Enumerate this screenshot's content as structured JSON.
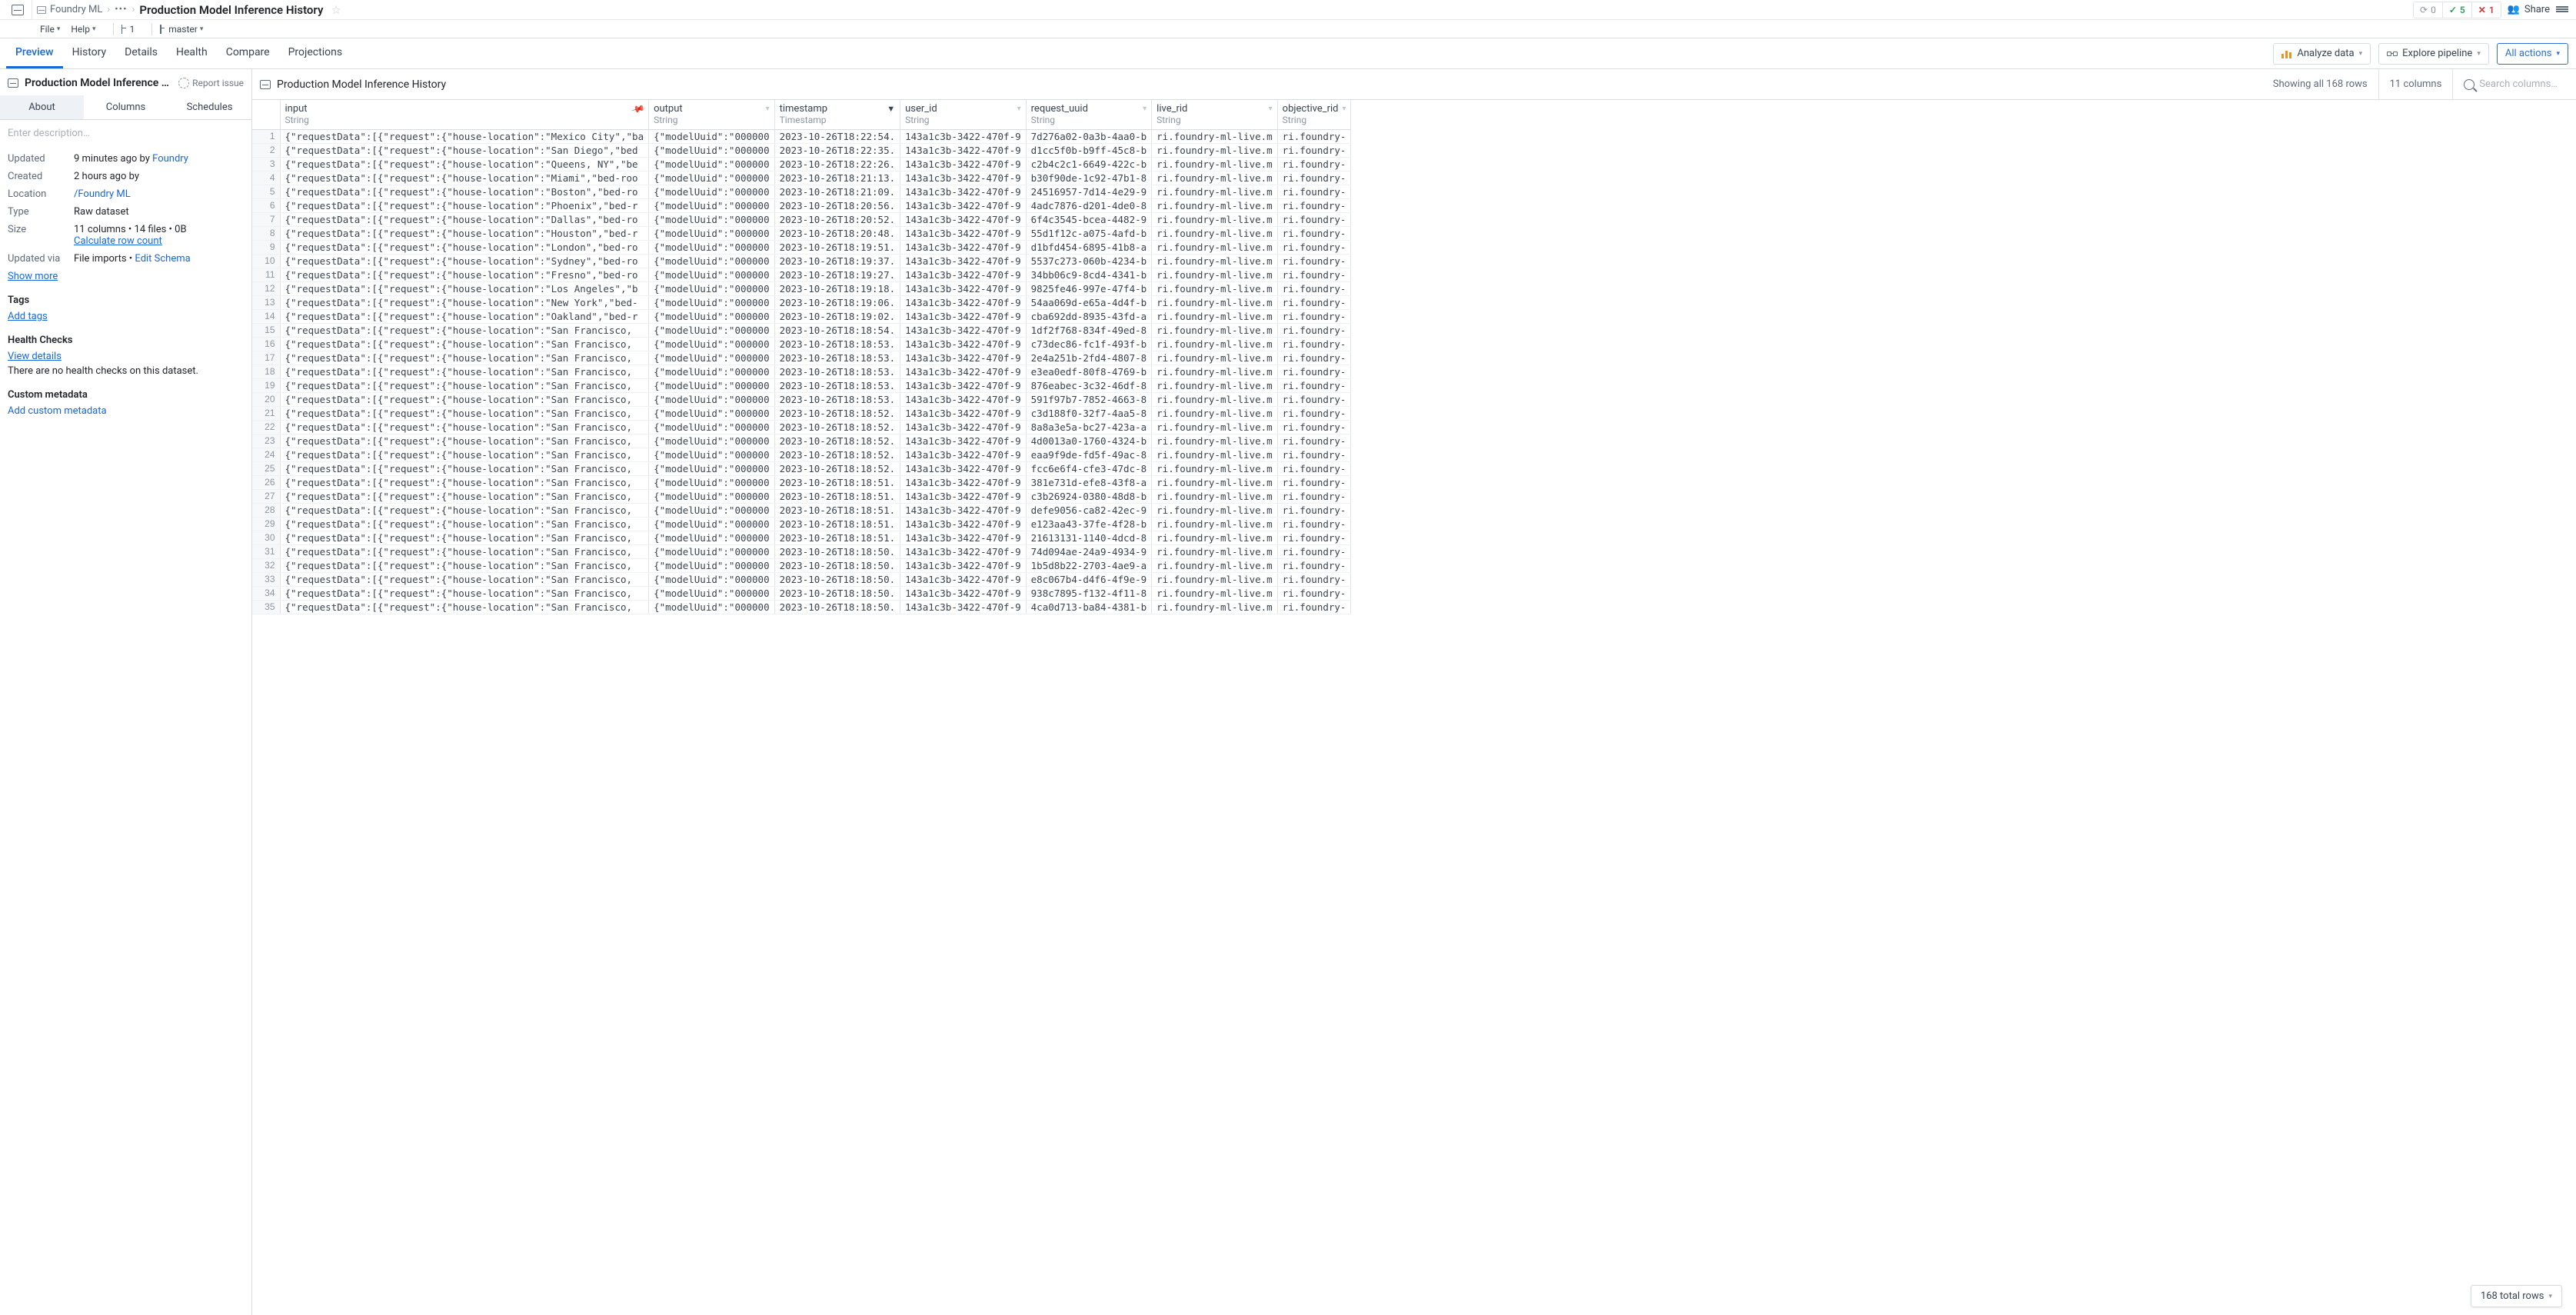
{
  "breadcrumb": {
    "project": "Foundry ML",
    "title": "Production Model Inference History"
  },
  "status": {
    "refresh": "0",
    "ok": "5",
    "err": "1"
  },
  "topbar": {
    "share": "Share"
  },
  "menubar": {
    "file": "File",
    "help": "Help",
    "branch_count": "1",
    "branch": "master"
  },
  "navtabs": [
    "Preview",
    "History",
    "Details",
    "Health",
    "Compare",
    "Projections"
  ],
  "nav_active": 0,
  "nav_buttons": {
    "analyze": "Analyze data",
    "explore": "Explore pipeline",
    "all_actions": "All actions"
  },
  "sidebar": {
    "title": "Production Model Inference History",
    "report_issue": "Report issue",
    "tabs": [
      "About",
      "Columns",
      "Schedules"
    ],
    "active_tab": 0,
    "description_placeholder": "Enter description…",
    "meta": {
      "updated_label": "Updated",
      "updated_value": "9 minutes ago by ",
      "updated_by": "Foundry",
      "created_label": "Created",
      "created_value": "2 hours ago by",
      "location_label": "Location",
      "location_value": "/Foundry ML",
      "type_label": "Type",
      "type_value": "Raw dataset",
      "size_label": "Size",
      "size_value": "11 columns • 14 files • 0B",
      "calc_rows": "Calculate row count",
      "updated_via_label": "Updated via",
      "updated_via_value": "File imports • ",
      "edit_schema": "Edit Schema",
      "show_more": "Show more"
    },
    "tags_h": "Tags",
    "add_tags": "Add tags",
    "health_h": "Health Checks",
    "view_details": "View details",
    "health_none": "There are no health checks on this dataset.",
    "custom_h": "Custom metadata",
    "add_custom": "Add custom metadata"
  },
  "content": {
    "title": "Production Model Inference History",
    "rows_stat": "Showing all 168 rows",
    "cols_stat": "11 columns",
    "search_placeholder": "Search columns…",
    "footer": "168 total rows"
  },
  "columns": [
    {
      "name": "input",
      "type": "String",
      "pin": true
    },
    {
      "name": "output",
      "type": "String"
    },
    {
      "name": "timestamp",
      "type": "Timestamp",
      "sort": "desc"
    },
    {
      "name": "user_id",
      "type": "String"
    },
    {
      "name": "request_uuid",
      "type": "String"
    },
    {
      "name": "live_rid",
      "type": "String"
    },
    {
      "name": "objective_rid",
      "type": "String"
    }
  ],
  "rows": [
    {
      "loc": "Mexico City",
      "inpSuffix": "\",\"ba",
      "ts": "2023-10-26T18:22:54.",
      "req": "7d276a02-0a3b-4aa0-b"
    },
    {
      "loc": "San Diego",
      "inpSuffix": "\",\"bed",
      "ts": "2023-10-26T18:22:35.",
      "req": "d1cc5f0b-b9ff-45c8-b"
    },
    {
      "loc": "Queens, NY",
      "inpSuffix": "\",\"be",
      "ts": "2023-10-26T18:22:26.",
      "req": "c2b4c2c1-6649-422c-b"
    },
    {
      "loc": "Miami",
      "inpSuffix": "\",\"bed-roo",
      "ts": "2023-10-26T18:21:13.",
      "req": "b30f90de-1c92-47b1-8"
    },
    {
      "loc": "Boston",
      "inpSuffix": "\",\"bed-ro",
      "ts": "2023-10-26T18:21:09.",
      "req": "24516957-7d14-4e29-9"
    },
    {
      "loc": "Phoenix",
      "inpSuffix": "\",\"bed-r",
      "ts": "2023-10-26T18:20:56.",
      "req": "4adc7876-d201-4de0-8"
    },
    {
      "loc": "Dallas",
      "inpSuffix": "\",\"bed-ro",
      "ts": "2023-10-26T18:20:52.",
      "req": "6f4c3545-bcea-4482-9"
    },
    {
      "loc": "Houston",
      "inpSuffix": "\",\"bed-r",
      "ts": "2023-10-26T18:20:48.",
      "req": "55d1f12c-a075-4afd-b"
    },
    {
      "loc": "London",
      "inpSuffix": "\",\"bed-ro",
      "ts": "2023-10-26T18:19:51.",
      "req": "d1bfd454-6895-41b8-a"
    },
    {
      "loc": "Sydney",
      "inpSuffix": "\",\"bed-ro",
      "ts": "2023-10-26T18:19:37.",
      "req": "5537c273-060b-4234-b"
    },
    {
      "loc": "Fresno",
      "inpSuffix": "\",\"bed-ro",
      "ts": "2023-10-26T18:19:27.",
      "req": "34bb06c9-8cd4-4341-b"
    },
    {
      "loc": "Los Angeles",
      "inpSuffix": "\",\"b",
      "ts": "2023-10-26T18:19:18.",
      "req": "9825fe46-997e-47f4-b"
    },
    {
      "loc": "New York",
      "inpSuffix": "\",\"bed-",
      "ts": "2023-10-26T18:19:06.",
      "req": "54aa069d-e65a-4d4f-b"
    },
    {
      "loc": "Oakland",
      "inpSuffix": "\",\"bed-r",
      "ts": "2023-10-26T18:19:02.",
      "req": "cba692dd-8935-43fd-a"
    },
    {
      "loc": "San Francisco",
      "inpSuffix": ",",
      "ts": "2023-10-26T18:18:54.",
      "req": "1df2f768-834f-49ed-8"
    },
    {
      "loc": "San Francisco",
      "inpSuffix": ",",
      "ts": "2023-10-26T18:18:53.",
      "req": "c73dec86-fc1f-493f-b"
    },
    {
      "loc": "San Francisco",
      "inpSuffix": ",",
      "ts": "2023-10-26T18:18:53.",
      "req": "2e4a251b-2fd4-4807-8"
    },
    {
      "loc": "San Francisco",
      "inpSuffix": ",",
      "ts": "2023-10-26T18:18:53.",
      "req": "e3ea0edf-80f8-4769-b"
    },
    {
      "loc": "San Francisco",
      "inpSuffix": ",",
      "ts": "2023-10-26T18:18:53.",
      "req": "876eabec-3c32-46df-8"
    },
    {
      "loc": "San Francisco",
      "inpSuffix": ",",
      "ts": "2023-10-26T18:18:53.",
      "req": "591f97b7-7852-4663-8"
    },
    {
      "loc": "San Francisco",
      "inpSuffix": ",",
      "ts": "2023-10-26T18:18:52.",
      "req": "c3d188f0-32f7-4aa5-8"
    },
    {
      "loc": "San Francisco",
      "inpSuffix": ",",
      "ts": "2023-10-26T18:18:52.",
      "req": "8a8a3e5a-bc27-423a-a"
    },
    {
      "loc": "San Francisco",
      "inpSuffix": ",",
      "ts": "2023-10-26T18:18:52.",
      "req": "4d0013a0-1760-4324-b"
    },
    {
      "loc": "San Francisco",
      "inpSuffix": ",",
      "ts": "2023-10-26T18:18:52.",
      "req": "eaa9f9de-fd5f-49ac-8"
    },
    {
      "loc": "San Francisco",
      "inpSuffix": ",",
      "ts": "2023-10-26T18:18:52.",
      "req": "fcc6e6f4-cfe3-47dc-8"
    },
    {
      "loc": "San Francisco",
      "inpSuffix": ",",
      "ts": "2023-10-26T18:18:51.",
      "req": "381e731d-efe8-43f8-a"
    },
    {
      "loc": "San Francisco",
      "inpSuffix": ",",
      "ts": "2023-10-26T18:18:51.",
      "req": "c3b26924-0380-48d8-b"
    },
    {
      "loc": "San Francisco",
      "inpSuffix": ",",
      "ts": "2023-10-26T18:18:51.",
      "req": "defe9056-ca82-42ec-9"
    },
    {
      "loc": "San Francisco",
      "inpSuffix": ",",
      "ts": "2023-10-26T18:18:51.",
      "req": "e123aa43-37fe-4f28-b"
    },
    {
      "loc": "San Francisco",
      "inpSuffix": ",",
      "ts": "2023-10-26T18:18:51.",
      "req": "21613131-1140-4dcd-8"
    },
    {
      "loc": "San Francisco",
      "inpSuffix": ",",
      "ts": "2023-10-26T18:18:50.",
      "req": "74d094ae-24a9-4934-9"
    },
    {
      "loc": "San Francisco",
      "inpSuffix": ",",
      "ts": "2023-10-26T18:18:50.",
      "req": "1b5d8b22-2703-4ae9-a"
    },
    {
      "loc": "San Francisco",
      "inpSuffix": ",",
      "ts": "2023-10-26T18:18:50.",
      "req": "e8c067b4-d4f6-4f9e-9"
    },
    {
      "loc": "San Francisco",
      "inpSuffix": ",",
      "ts": "2023-10-26T18:18:50.",
      "req": "938c7895-f132-4f11-8"
    },
    {
      "loc": "San Francisco",
      "inpSuffix": ",",
      "ts": "2023-10-26T18:18:50.",
      "req": "4ca0d713-ba84-4381-b"
    }
  ],
  "row_constants": {
    "input_prefix": "{\"requestData\":[{\"request\":{\"house-location\":\"",
    "output": "{\"modelUuid\":\"000000",
    "user_id": "143a1c3b-3422-470f-9",
    "live_rid": "ri.foundry-ml-live.m",
    "objective_rid": "ri.foundry-"
  }
}
